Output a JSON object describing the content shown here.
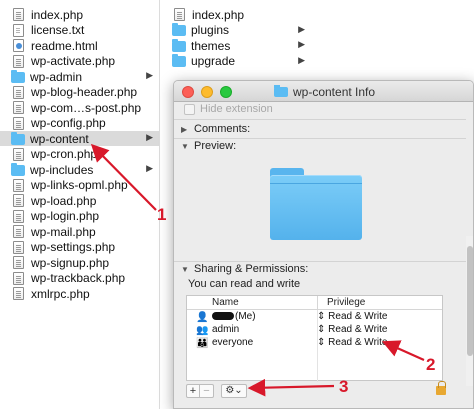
{
  "finder": {
    "column1": [
      {
        "name": "index.php",
        "kind": "php"
      },
      {
        "name": "license.txt",
        "kind": "txt"
      },
      {
        "name": "readme.html",
        "kind": "html"
      },
      {
        "name": "wp-activate.php",
        "kind": "php"
      },
      {
        "name": "wp-admin",
        "kind": "folder"
      },
      {
        "name": "wp-blog-header.php",
        "kind": "php"
      },
      {
        "name": "wp-com…s-post.php",
        "kind": "php"
      },
      {
        "name": "wp-config.php",
        "kind": "php"
      },
      {
        "name": "wp-content",
        "kind": "folder",
        "selected": true
      },
      {
        "name": "wp-cron.php",
        "kind": "php"
      },
      {
        "name": "wp-includes",
        "kind": "folder"
      },
      {
        "name": "wp-links-opml.php",
        "kind": "php"
      },
      {
        "name": "wp-load.php",
        "kind": "php"
      },
      {
        "name": "wp-login.php",
        "kind": "php"
      },
      {
        "name": "wp-mail.php",
        "kind": "php"
      },
      {
        "name": "wp-settings.php",
        "kind": "php"
      },
      {
        "name": "wp-signup.php",
        "kind": "php"
      },
      {
        "name": "wp-trackback.php",
        "kind": "php"
      },
      {
        "name": "xmlrpc.php",
        "kind": "php"
      }
    ],
    "column2": [
      {
        "name": "index.php",
        "kind": "php"
      },
      {
        "name": "plugins",
        "kind": "folder"
      },
      {
        "name": "themes",
        "kind": "folder"
      },
      {
        "name": "upgrade",
        "kind": "folder"
      }
    ]
  },
  "info_window": {
    "title": "wp-content Info",
    "hide_extension": "Hide extension",
    "comments": "Comments:",
    "preview": "Preview:",
    "sharing": "Sharing & Permissions:",
    "can_read_write": "You can read and write",
    "headers": {
      "name": "Name",
      "privilege": "Privilege"
    },
    "rows": [
      {
        "icon": "user-icon",
        "name": "(Me)",
        "privilege": "Read & Write"
      },
      {
        "icon": "group-icon",
        "name": "admin",
        "privilege": "Read & Write"
      },
      {
        "icon": "everyone-icon",
        "name": "everyone",
        "privilege": "Read & Write"
      }
    ],
    "add_label": "+",
    "remove_label": "−",
    "gear_label": "⚙⌄"
  },
  "annotations": {
    "one": "1",
    "two": "2",
    "three": "3",
    "color": "#d8182a"
  }
}
